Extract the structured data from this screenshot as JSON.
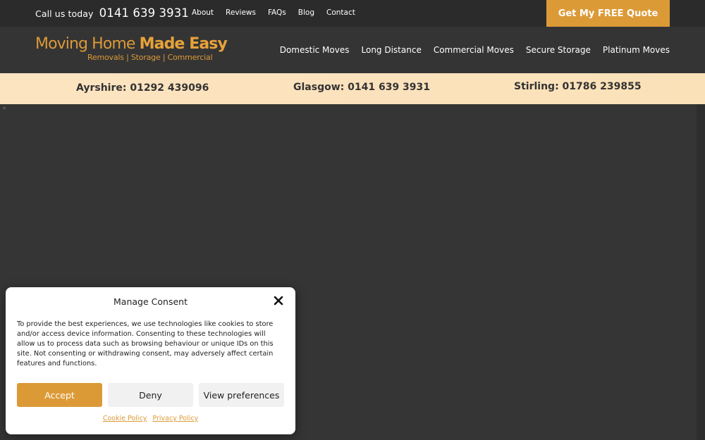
{
  "topbar": {
    "call_label": "Call us today",
    "call_number": "0141 639 3931",
    "nav": [
      "About",
      "Reviews",
      "FAQs",
      "Blog",
      "Contact"
    ],
    "quote_button": "Get My FREE Quote"
  },
  "header": {
    "logo_line1_regular": "Moving Home ",
    "logo_line1_bold": "Made Easy",
    "logo_line2": "Removals | Storage | Commercial",
    "nav": [
      "Domestic Moves",
      "Long Distance",
      "Commercial Moves",
      "Secure Storage",
      "Platinum Moves"
    ]
  },
  "phones": [
    "Ayrshire: 01292 439096",
    "Glasgow: 0141 639 3931",
    "Stirling: 01786 239855"
  ],
  "consent": {
    "title": "Manage Consent",
    "body": "To provide the best experiences, we use technologies like cookies to store and/or access device information. Consenting to these technologies will allow us to process data such as browsing behaviour or unique IDs on this site. Not consenting or withdrawing consent, may adversely affect certain features and functions.",
    "accept": "Accept",
    "deny": "Deny",
    "preferences": "View preferences",
    "cookie_policy": "Cookie Policy",
    "privacy_policy": "Privacy Policy"
  },
  "colors": {
    "accent": "#dc9a37",
    "dark": "#343434",
    "topbar": "#2b2b2b",
    "phonebar": "#fde4c1"
  }
}
